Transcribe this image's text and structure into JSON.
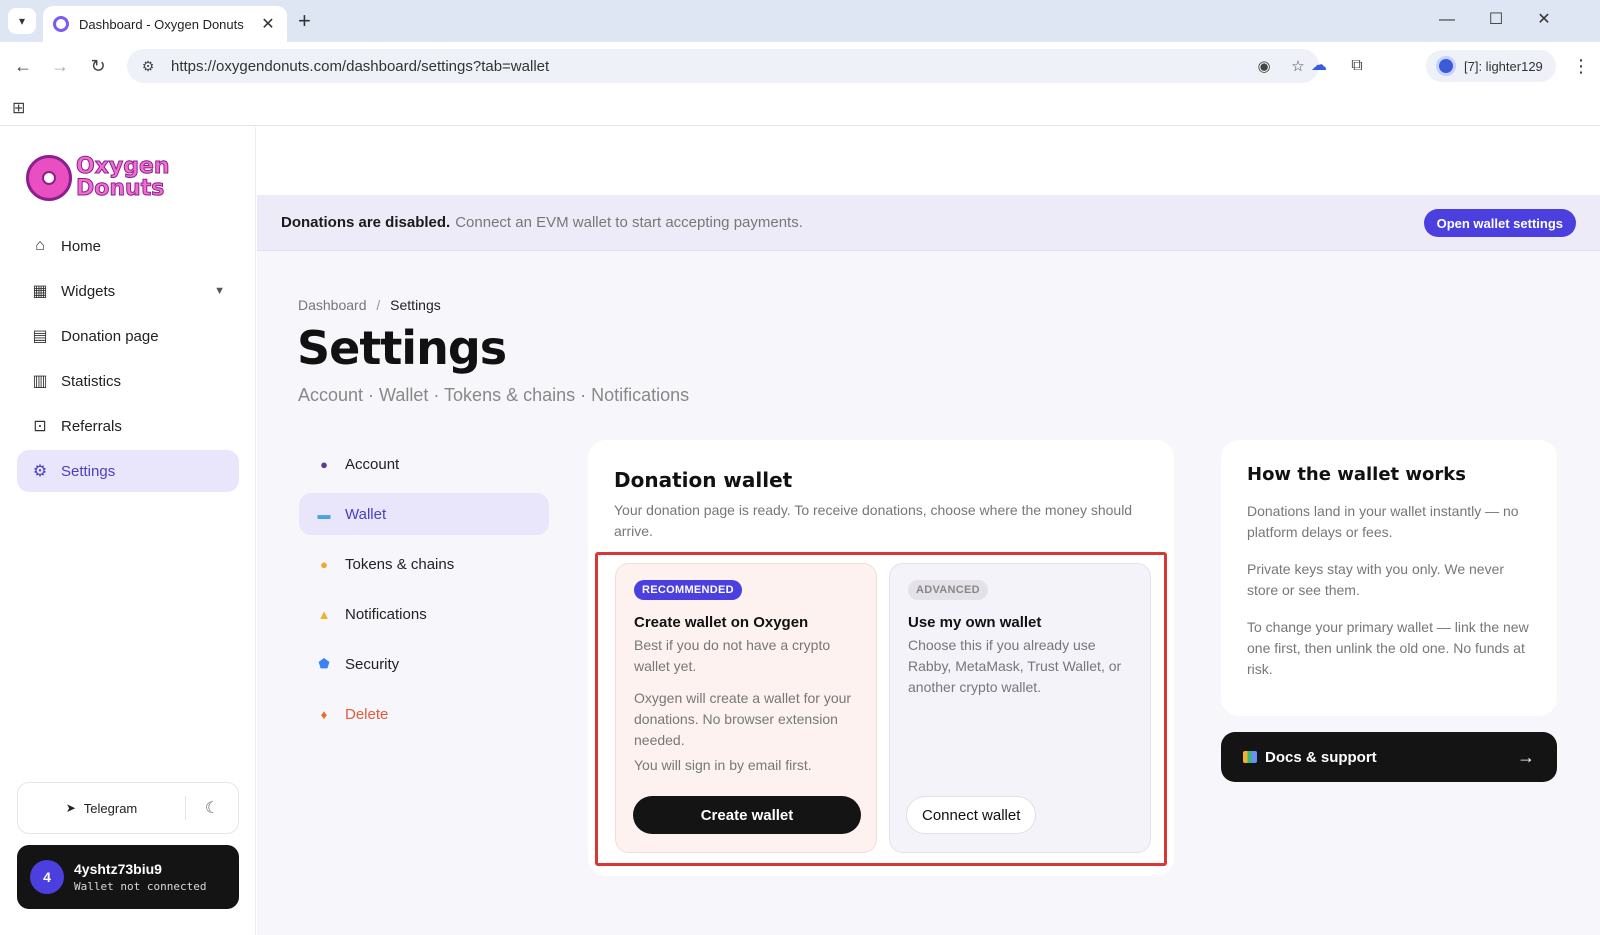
{
  "browser": {
    "tab_title": "Dashboard - Oxygen Donuts",
    "url": "https://oxygendonuts.com/dashboard/settings?tab=wallet",
    "profile_label": "[7]: lighter129"
  },
  "sidebar": {
    "logo_line1": "Oxygen",
    "logo_line2": "Donuts",
    "items": [
      {
        "label": "Home",
        "icon": "home-icon"
      },
      {
        "label": "Widgets",
        "icon": "grid-icon"
      },
      {
        "label": "Donation page",
        "icon": "document-icon"
      },
      {
        "label": "Statistics",
        "icon": "bar-chart-icon"
      },
      {
        "label": "Referrals",
        "icon": "gift-icon"
      },
      {
        "label": "Settings",
        "icon": "gear-icon"
      }
    ],
    "telegram_label": "Telegram",
    "user": {
      "avatar_letter": "4",
      "name": "4yshtz73biu9",
      "status": "Wallet not connected"
    }
  },
  "banner": {
    "strong": "Donations are disabled.",
    "text": "Connect an EVM wallet to start accepting payments.",
    "button": "Open wallet settings"
  },
  "breadcrumb": {
    "root": "Dashboard",
    "separator": "/",
    "current": "Settings"
  },
  "page": {
    "title": "Settings",
    "subtitle": "Account · Wallet · Tokens & chains · Notifications"
  },
  "subnav": [
    {
      "label": "Account"
    },
    {
      "label": "Wallet"
    },
    {
      "label": "Tokens & chains"
    },
    {
      "label": "Notifications"
    },
    {
      "label": "Security"
    },
    {
      "label": "Delete"
    }
  ],
  "wallet_card": {
    "title": "Donation wallet",
    "description": "Your donation page is ready. To receive donations, choose where the money should arrive.",
    "recommended": {
      "badge": "RECOMMENDED",
      "title": "Create wallet on Oxygen",
      "text": "Best if you do not have a crypto wallet yet.",
      "note": "Oxygen will create a wallet for your donations. No browser extension needed.",
      "note2": "You will sign in by email first.",
      "button": "Create wallet"
    },
    "advanced": {
      "badge": "ADVANCED",
      "title": "Use my own wallet",
      "text": "Choose this if you already use Rabby, MetaMask, Trust Wallet, or another crypto wallet.",
      "button": "Connect wallet"
    }
  },
  "how_card": {
    "title": "How the wallet works",
    "p1": "Donations land in your wallet instantly — no platform delays or fees.",
    "p2": "Private keys stay with you only. We never store or see them.",
    "p3": "To change your primary wallet — link the new one first, then unlink the old one. No funds at risk."
  },
  "docs_button": {
    "label": "Docs & support",
    "arrow": "→"
  },
  "colors": {
    "accent": "#4b3fe0",
    "active_bg": "#e9e6fb",
    "danger": "#e35b3a",
    "highlight_frame": "#d93636"
  }
}
